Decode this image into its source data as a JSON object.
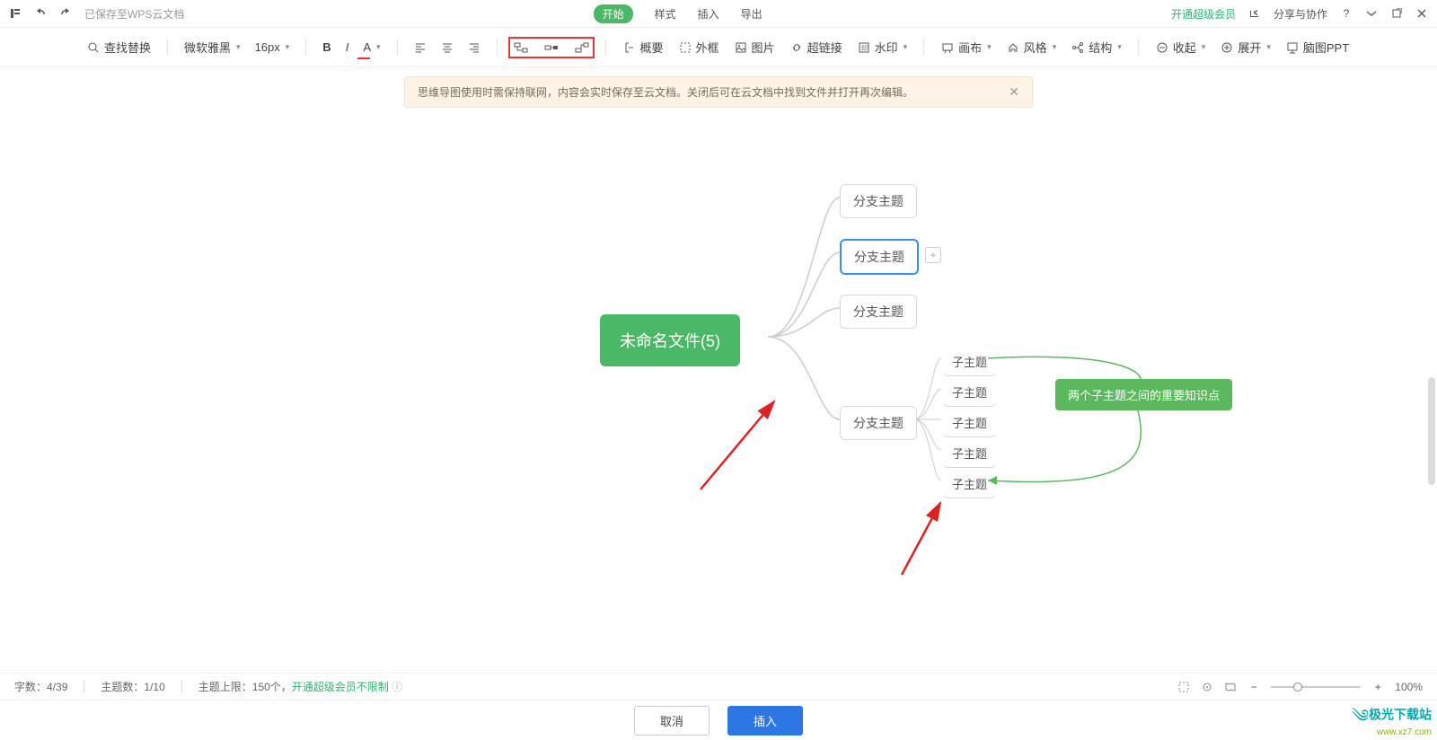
{
  "titlebar": {
    "saved_text": "已保存至WPS云文档",
    "tabs": {
      "start": "开始",
      "style": "样式",
      "insert": "插入",
      "export": "导出"
    },
    "vip": "开通超级会员",
    "share": "分享与协作"
  },
  "toolbar": {
    "find_replace": "查找替换",
    "font_name": "微软雅黑",
    "font_size": "16px",
    "summary": "概要",
    "frame": "外框",
    "image": "图片",
    "hyperlink": "超链接",
    "watermark": "水印",
    "canvas": "画布",
    "style": "风格",
    "structure": "结构",
    "collapse": "收起",
    "expand": "展开",
    "mindmap_ppt": "脑图PPT"
  },
  "banner": {
    "text": "思维导图使用时需保持联网，内容会实时保存至云文档。关闭后可在云文档中找到文件并打开再次编辑。"
  },
  "mindmap": {
    "root": "未命名文件(5)",
    "branches": [
      "分支主题",
      "分支主题",
      "分支主题",
      "分支主题"
    ],
    "subs": [
      "子主题",
      "子主题",
      "子主题",
      "子主题",
      "子主题"
    ],
    "callout": "两个子主题之间的重要知识点"
  },
  "statusbar": {
    "word_count_label": "字数：",
    "word_count_value": "4/39",
    "topic_count_label": "主题数：",
    "topic_count_value": "1/10",
    "topic_limit_label": "主题上限：",
    "topic_limit_value": "150个，",
    "upgrade_link": "开通超级会员不限制",
    "zoom": "100%"
  },
  "actions": {
    "cancel": "取消",
    "insert": "插入"
  },
  "watermark": {
    "cn": "极光下载站",
    "url": "www.xz7.com"
  }
}
